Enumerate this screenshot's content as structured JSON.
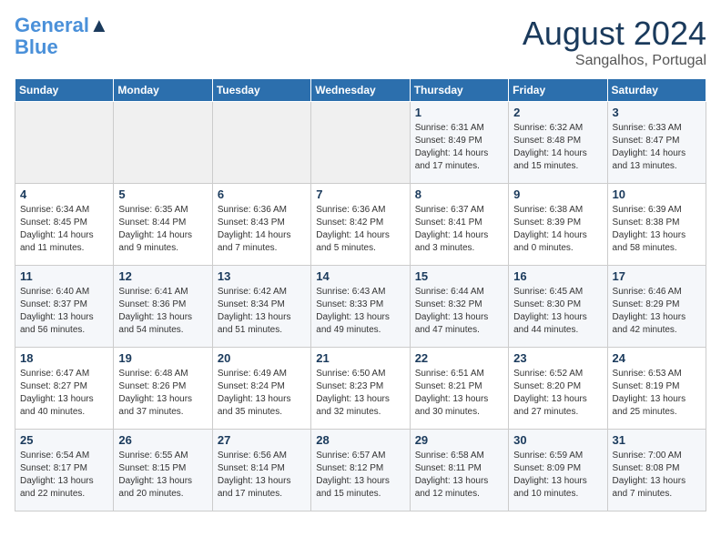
{
  "header": {
    "logo_line1": "General",
    "logo_line2": "Blue",
    "month_year": "August 2024",
    "location": "Sangalhos, Portugal"
  },
  "weekdays": [
    "Sunday",
    "Monday",
    "Tuesday",
    "Wednesday",
    "Thursday",
    "Friday",
    "Saturday"
  ],
  "weeks": [
    [
      {
        "day": "",
        "info": ""
      },
      {
        "day": "",
        "info": ""
      },
      {
        "day": "",
        "info": ""
      },
      {
        "day": "",
        "info": ""
      },
      {
        "day": "1",
        "info": "Sunrise: 6:31 AM\nSunset: 8:49 PM\nDaylight: 14 hours and 17 minutes."
      },
      {
        "day": "2",
        "info": "Sunrise: 6:32 AM\nSunset: 8:48 PM\nDaylight: 14 hours and 15 minutes."
      },
      {
        "day": "3",
        "info": "Sunrise: 6:33 AM\nSunset: 8:47 PM\nDaylight: 14 hours and 13 minutes."
      }
    ],
    [
      {
        "day": "4",
        "info": "Sunrise: 6:34 AM\nSunset: 8:45 PM\nDaylight: 14 hours and 11 minutes."
      },
      {
        "day": "5",
        "info": "Sunrise: 6:35 AM\nSunset: 8:44 PM\nDaylight: 14 hours and 9 minutes."
      },
      {
        "day": "6",
        "info": "Sunrise: 6:36 AM\nSunset: 8:43 PM\nDaylight: 14 hours and 7 minutes."
      },
      {
        "day": "7",
        "info": "Sunrise: 6:36 AM\nSunset: 8:42 PM\nDaylight: 14 hours and 5 minutes."
      },
      {
        "day": "8",
        "info": "Sunrise: 6:37 AM\nSunset: 8:41 PM\nDaylight: 14 hours and 3 minutes."
      },
      {
        "day": "9",
        "info": "Sunrise: 6:38 AM\nSunset: 8:39 PM\nDaylight: 14 hours and 0 minutes."
      },
      {
        "day": "10",
        "info": "Sunrise: 6:39 AM\nSunset: 8:38 PM\nDaylight: 13 hours and 58 minutes."
      }
    ],
    [
      {
        "day": "11",
        "info": "Sunrise: 6:40 AM\nSunset: 8:37 PM\nDaylight: 13 hours and 56 minutes."
      },
      {
        "day": "12",
        "info": "Sunrise: 6:41 AM\nSunset: 8:36 PM\nDaylight: 13 hours and 54 minutes."
      },
      {
        "day": "13",
        "info": "Sunrise: 6:42 AM\nSunset: 8:34 PM\nDaylight: 13 hours and 51 minutes."
      },
      {
        "day": "14",
        "info": "Sunrise: 6:43 AM\nSunset: 8:33 PM\nDaylight: 13 hours and 49 minutes."
      },
      {
        "day": "15",
        "info": "Sunrise: 6:44 AM\nSunset: 8:32 PM\nDaylight: 13 hours and 47 minutes."
      },
      {
        "day": "16",
        "info": "Sunrise: 6:45 AM\nSunset: 8:30 PM\nDaylight: 13 hours and 44 minutes."
      },
      {
        "day": "17",
        "info": "Sunrise: 6:46 AM\nSunset: 8:29 PM\nDaylight: 13 hours and 42 minutes."
      }
    ],
    [
      {
        "day": "18",
        "info": "Sunrise: 6:47 AM\nSunset: 8:27 PM\nDaylight: 13 hours and 40 minutes."
      },
      {
        "day": "19",
        "info": "Sunrise: 6:48 AM\nSunset: 8:26 PM\nDaylight: 13 hours and 37 minutes."
      },
      {
        "day": "20",
        "info": "Sunrise: 6:49 AM\nSunset: 8:24 PM\nDaylight: 13 hours and 35 minutes."
      },
      {
        "day": "21",
        "info": "Sunrise: 6:50 AM\nSunset: 8:23 PM\nDaylight: 13 hours and 32 minutes."
      },
      {
        "day": "22",
        "info": "Sunrise: 6:51 AM\nSunset: 8:21 PM\nDaylight: 13 hours and 30 minutes."
      },
      {
        "day": "23",
        "info": "Sunrise: 6:52 AM\nSunset: 8:20 PM\nDaylight: 13 hours and 27 minutes."
      },
      {
        "day": "24",
        "info": "Sunrise: 6:53 AM\nSunset: 8:19 PM\nDaylight: 13 hours and 25 minutes."
      }
    ],
    [
      {
        "day": "25",
        "info": "Sunrise: 6:54 AM\nSunset: 8:17 PM\nDaylight: 13 hours and 22 minutes."
      },
      {
        "day": "26",
        "info": "Sunrise: 6:55 AM\nSunset: 8:15 PM\nDaylight: 13 hours and 20 minutes."
      },
      {
        "day": "27",
        "info": "Sunrise: 6:56 AM\nSunset: 8:14 PM\nDaylight: 13 hours and 17 minutes."
      },
      {
        "day": "28",
        "info": "Sunrise: 6:57 AM\nSunset: 8:12 PM\nDaylight: 13 hours and 15 minutes."
      },
      {
        "day": "29",
        "info": "Sunrise: 6:58 AM\nSunset: 8:11 PM\nDaylight: 13 hours and 12 minutes."
      },
      {
        "day": "30",
        "info": "Sunrise: 6:59 AM\nSunset: 8:09 PM\nDaylight: 13 hours and 10 minutes."
      },
      {
        "day": "31",
        "info": "Sunrise: 7:00 AM\nSunset: 8:08 PM\nDaylight: 13 hours and 7 minutes."
      }
    ]
  ]
}
